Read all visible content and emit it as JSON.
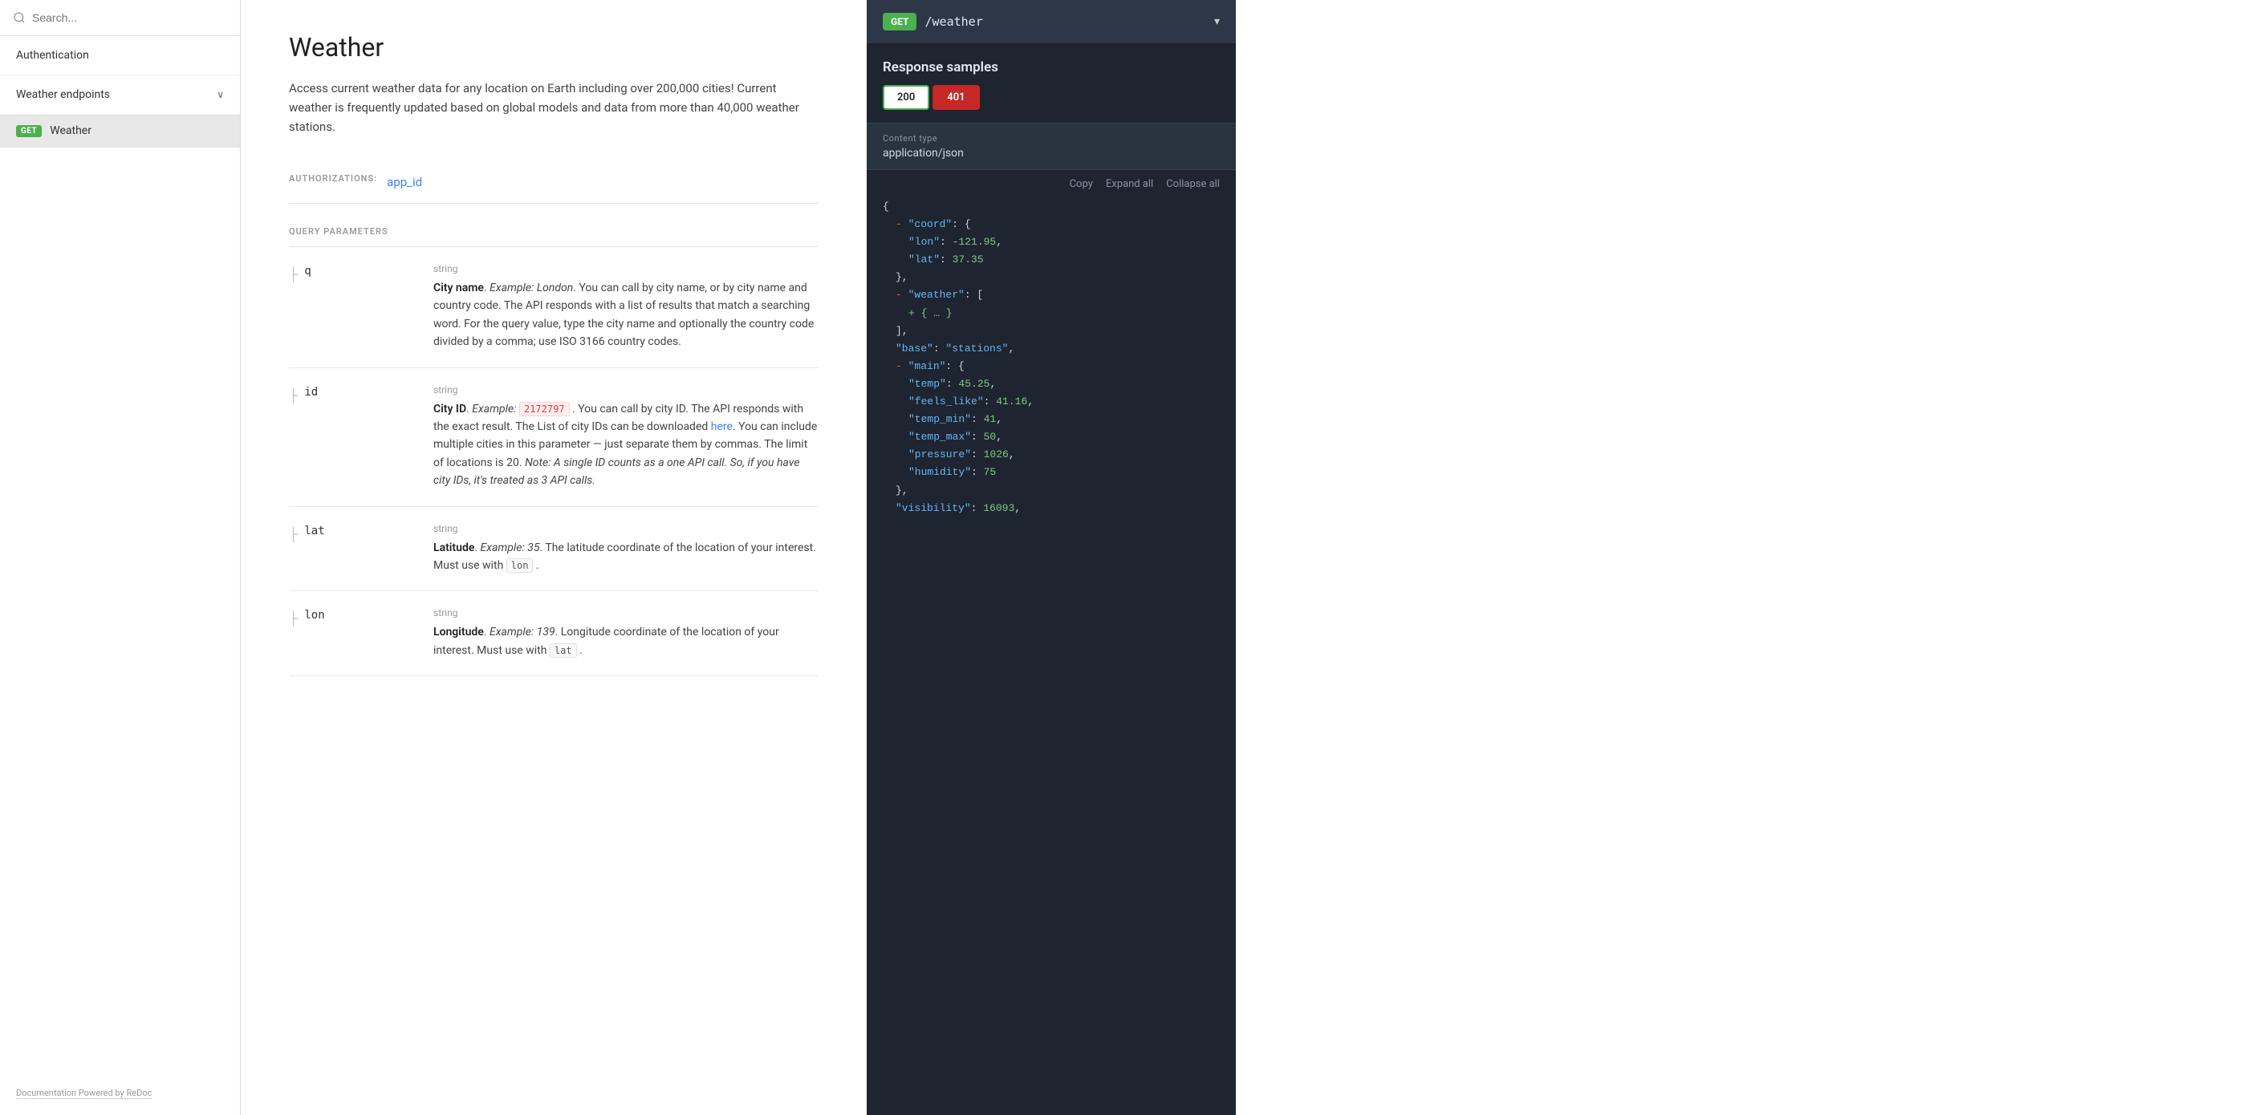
{
  "sidebar": {
    "search_placeholder": "Search...",
    "nav_items": [
      {
        "id": "authentication",
        "label": "Authentication",
        "type": "link"
      },
      {
        "id": "weather-endpoints",
        "label": "Weather endpoints",
        "type": "section",
        "expanded": true
      },
      {
        "id": "weather",
        "label": "Weather",
        "type": "endpoint",
        "method": "GET"
      }
    ],
    "footer_link": "Documentation Powered by ReDoc"
  },
  "main": {
    "title": "Weather",
    "description": "Access current weather data for any location on Earth including over 200,000 cities! Current weather is frequently updated based on global models and data from more than 40,000 weather stations.",
    "authorizations_label": "AUTHORIZATIONS:",
    "auth_link": "app_id",
    "query_params_label": "QUERY PARAMETERS",
    "params": [
      {
        "name": "q",
        "type": "string",
        "description_bold": "City name",
        "description_italic": "Example: London",
        "description_rest": ". You can call by city name, or by city name and country code. The API responds with a list of results that match a searching word. For the query value, type the city name and optionally the country code divided by a comma; use ISO 3166 country codes."
      },
      {
        "name": "id",
        "type": "string",
        "description_bold": "City ID",
        "description_italic": "Example:",
        "code_value": "2172797",
        "description_rest": ". You can call by city ID. The API responds with the exact result. The List of city IDs can be downloaded",
        "link_text": "here",
        "description_after_link": ". You can include multiple cities in this parameter — just separate them by commas. The limit of locations is 20.",
        "description_italic2": "Note: A single ID counts as a one API call. So, if you have city IDs, it's treated as 3 API calls."
      },
      {
        "name": "lat",
        "type": "string",
        "description_bold": "Latitude",
        "description_italic": "Example: 35",
        "description_rest": ". The latitude coordinate of the location of your interest. Must use with",
        "inline_code": "lon",
        "description_end": "."
      },
      {
        "name": "lon",
        "type": "string",
        "description_bold": "Longitude",
        "description_italic": "Example: 139",
        "description_rest": ". Longitude coordinate of the location of your"
      }
    ]
  },
  "right_panel": {
    "method": "GET",
    "path": "/weather",
    "response_samples_label": "Response samples",
    "tabs": [
      {
        "code": "200",
        "type": "success"
      },
      {
        "code": "401",
        "type": "error"
      }
    ],
    "content_type_label": "Content type",
    "content_type_value": "application/json",
    "actions": [
      "Copy",
      "Expand all",
      "Collapse all"
    ],
    "json_lines": [
      {
        "indent": 0,
        "text": "{",
        "class": "c-brace"
      },
      {
        "indent": 1,
        "prefix": "- ",
        "key": "\"coord\"",
        "suffix": ": {",
        "prefix_class": "c-minus",
        "key_class": "c-str",
        "suffix_class": "c-brace"
      },
      {
        "indent": 2,
        "key": "\"lon\"",
        "suffix": ": ",
        "value": "-121.95",
        "value_suffix": ",",
        "key_class": "c-key",
        "value_class": "c-num"
      },
      {
        "indent": 2,
        "key": "\"lat\"",
        "suffix": ": ",
        "value": "37.35",
        "key_class": "c-key",
        "value_class": "c-num"
      },
      {
        "indent": 1,
        "text": "},",
        "class": "c-brace"
      },
      {
        "indent": 1,
        "prefix": "- ",
        "key": "\"weather\"",
        "suffix": ": [",
        "prefix_class": "c-minus",
        "key_class": "c-str",
        "suffix_class": "c-brace"
      },
      {
        "indent": 2,
        "text": "+ { … }",
        "class": "c-plus"
      },
      {
        "indent": 1,
        "text": "],",
        "class": "c-brace"
      },
      {
        "indent": 1,
        "key": "\"base\"",
        "suffix": ": ",
        "value": "\"stations\"",
        "value_suffix": ",",
        "key_class": "c-key",
        "value_class": "c-str"
      },
      {
        "indent": 1,
        "prefix": "- ",
        "key": "\"main\"",
        "suffix": ": {",
        "prefix_class": "c-minus",
        "key_class": "c-str",
        "suffix_class": "c-brace"
      },
      {
        "indent": 2,
        "key": "\"temp\"",
        "suffix": ": ",
        "value": "45.25",
        "value_suffix": ",",
        "key_class": "c-key",
        "value_class": "c-num"
      },
      {
        "indent": 2,
        "key": "\"feels_like\"",
        "suffix": ": ",
        "value": "41.16",
        "value_suffix": ",",
        "key_class": "c-key",
        "value_class": "c-num"
      },
      {
        "indent": 2,
        "key": "\"temp_min\"",
        "suffix": ": ",
        "value": "41",
        "value_suffix": ",",
        "key_class": "c-key",
        "value_class": "c-num"
      },
      {
        "indent": 2,
        "key": "\"temp_max\"",
        "suffix": ": ",
        "value": "50",
        "value_suffix": ",",
        "key_class": "c-key",
        "value_class": "c-num"
      },
      {
        "indent": 2,
        "key": "\"pressure\"",
        "suffix": ": ",
        "value": "1026",
        "value_suffix": ",",
        "key_class": "c-key",
        "value_class": "c-num"
      },
      {
        "indent": 2,
        "key": "\"humidity\"",
        "suffix": ": ",
        "value": "75",
        "key_class": "c-key",
        "value_class": "c-num"
      },
      {
        "indent": 1,
        "text": "},",
        "class": "c-brace"
      },
      {
        "indent": 1,
        "key": "\"visibility\"",
        "suffix": ": ",
        "value": "16093",
        "value_suffix": ",",
        "key_class": "c-key",
        "value_class": "c-num"
      }
    ]
  }
}
